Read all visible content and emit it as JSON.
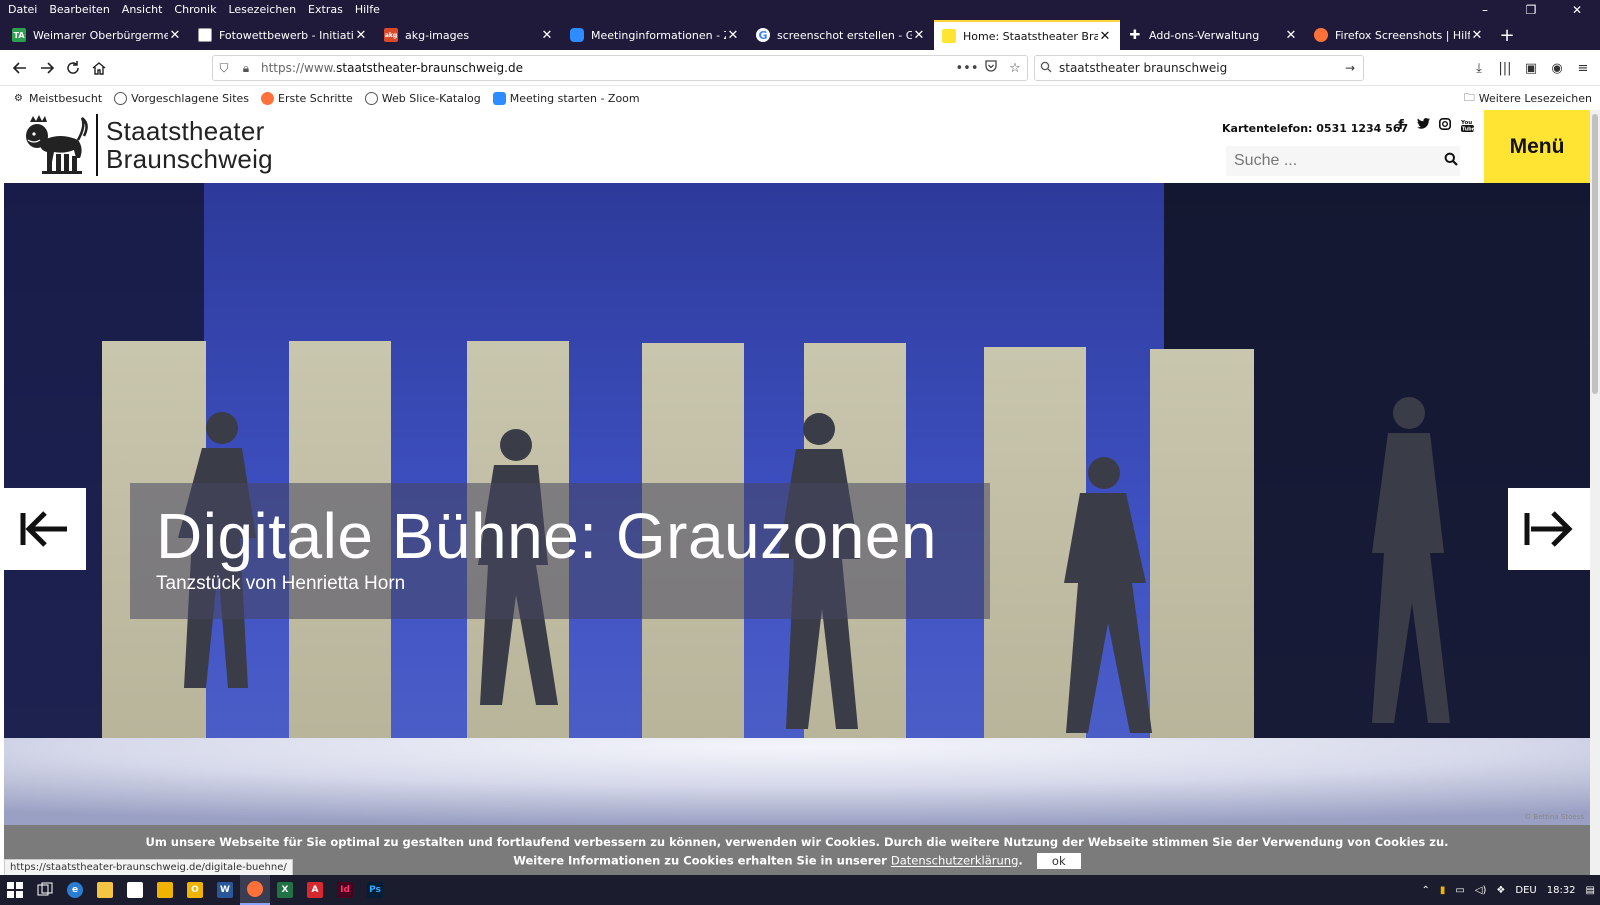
{
  "menubar": {
    "items": [
      "Datei",
      "Bearbeiten",
      "Ansicht",
      "Chronik",
      "Lesezeichen",
      "Extras",
      "Hilfe"
    ],
    "window_controls": [
      "–",
      "❐",
      "✕"
    ]
  },
  "tabs": [
    {
      "title": "Weimarer Oberbürgermeister z",
      "fav": "TA",
      "fav_color": "#2e9e4f",
      "active": false
    },
    {
      "title": "Fotowettbewerb - Initiative Kul",
      "fav": "",
      "fav_color": "#ffffff",
      "active": false
    },
    {
      "title": "akg-images",
      "fav": "akg",
      "fav_color": "#d94a2b",
      "active": false
    },
    {
      "title": "Meetinginformationen - Zoom",
      "fav": "",
      "fav_color": "#2d8cff",
      "active": false
    },
    {
      "title": "screenschot erstellen - Google",
      "fav": "G",
      "fav_color": "#ffffff",
      "active": false
    },
    {
      "title": "Home: Staatstheater Braunsch",
      "fav": "",
      "fav_color": "#ffe433",
      "active": true
    },
    {
      "title": "Add-ons-Verwaltung",
      "fav": "",
      "fav_color": "#ffffff",
      "active": false
    },
    {
      "title": "Firefox Screenshots | Hilfe zu Fi",
      "fav": "",
      "fav_color": "#ff7139",
      "active": false
    }
  ],
  "navbar": {
    "url_prefix": "https://www.",
    "url_domain": "staatstheater-braunschweig.de",
    "search_value": "staatstheater braunschweig"
  },
  "bookmarks": {
    "items": [
      "Meistbesucht",
      "Vorgeschlagene Sites",
      "Erste Schritte",
      "Web Slice-Katalog",
      "Meeting starten - Zoom"
    ],
    "more": "Weitere Lesezeichen"
  },
  "site": {
    "logo_line1": "Staatstheater",
    "logo_line2": "Braunschweig",
    "phone": "Kartentelefon: 0531 1234 567",
    "search_placeholder": "Suche ...",
    "menu_label": "Menü",
    "social": [
      "f",
      "t",
      "ig",
      "yt"
    ]
  },
  "hero": {
    "title": "Digitale Bühne: Grauzonen",
    "subtitle": "Tanzstück von Henrietta Horn",
    "credit": "© Bettina Stoess"
  },
  "cookie": {
    "line1": "Um unsere Webseite für Sie optimal zu gestalten und fortlaufend verbessern zu können, verwenden wir Cookies. Durch die weitere Nutzung der Webseite stimmen Sie der Verwendung von Cookies zu.",
    "line2_prefix": "Weitere Informationen zu Cookies erhalten Sie in unserer",
    "line2_link": "Datenschutzerklärung",
    "line2_suffix": ".",
    "ok_label": "ok"
  },
  "status_url": "https://staatstheater-braunschweig.de/digitale-buehne/",
  "taskbar": {
    "apps": [
      {
        "name": "windows-start",
        "label": "",
        "color": "#ffffff"
      },
      {
        "name": "task-view",
        "label": "",
        "color": "#ffffff"
      },
      {
        "name": "edge",
        "label": "e",
        "color": "#2b7cd3"
      },
      {
        "name": "explorer",
        "label": "",
        "color": "#f4c542"
      },
      {
        "name": "store",
        "label": "",
        "color": "#ffffff"
      },
      {
        "name": "media",
        "label": "",
        "color": "#f0b400"
      },
      {
        "name": "outlook-yellow",
        "label": "O",
        "color": "#f0b400"
      },
      {
        "name": "word",
        "label": "W",
        "color": "#2b579a"
      },
      {
        "name": "firefox",
        "label": "",
        "color": "#ff7139"
      },
      {
        "name": "excel",
        "label": "X",
        "color": "#217346"
      },
      {
        "name": "acrobat",
        "label": "A",
        "color": "#d7282f"
      },
      {
        "name": "indesign",
        "label": "Id",
        "color": "#49021f"
      },
      {
        "name": "photoshop",
        "label": "Ps",
        "color": "#001e36"
      }
    ],
    "language": "DEU",
    "time": "18:32"
  }
}
